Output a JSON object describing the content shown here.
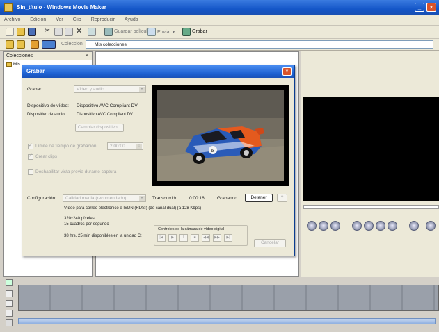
{
  "window": {
    "title": "Sin_título - Windows Movie Maker"
  },
  "menubar": {
    "items": [
      "Archivo",
      "Edición",
      "Ver",
      "Clip",
      "Reproducir",
      "Ayuda"
    ]
  },
  "toolbar": {
    "grabar_label": "Grabar",
    "coleccion_label": "Colección",
    "address_value": "Mis colecciones"
  },
  "left_pane": {
    "header": "Colecciones",
    "close": "×",
    "item": "Mis"
  },
  "dialog": {
    "title": "Grabar",
    "close": "×",
    "grabar_label": "Grabar:",
    "grabar_value": "Vídeo y audio",
    "video_device_label": "Dispositivo de vídeo:",
    "video_device_value": "Dispositivo AVC Compliant DV",
    "audio_device_label": "Dispositivo de audio:",
    "audio_device_value": "Dispositivo AVC Compliant DV",
    "cambiar_button": "Cambiar dispositivo...",
    "time_limit_label": "Límite de tiempo de grabación:",
    "time_limit_value": "2:00:00",
    "create_clips_label": "Crear clips",
    "disable_preview_label": "Deshabilitar vista previa durante captura",
    "config_label": "Configuración:",
    "config_value": "Calidad media (recomendado)",
    "transcurrido_label": "Transcurrido",
    "transcurrido_value": "0:00:16",
    "grabando_label": "Grabando",
    "detener_button": "Detener",
    "desc_line": "Vídeo para correo electrónico e ISDN (RDSI) (de canal dual) (a 128 Kbps)",
    "resolution": "320x240 píxeles",
    "fps": "15 cuadros por segundo",
    "disk_info": "38 hrs. 25 min disponibles en la unidad C:",
    "camera_controls_title": "Controles de la cámara de vídeo digital",
    "cancel_button": "Cancelar"
  },
  "colors": {
    "title_blue": "#1456c8",
    "dialog_bg": "#ece9d8",
    "car_orange": "#e45a1e",
    "car_blue": "#2a5bb8"
  }
}
